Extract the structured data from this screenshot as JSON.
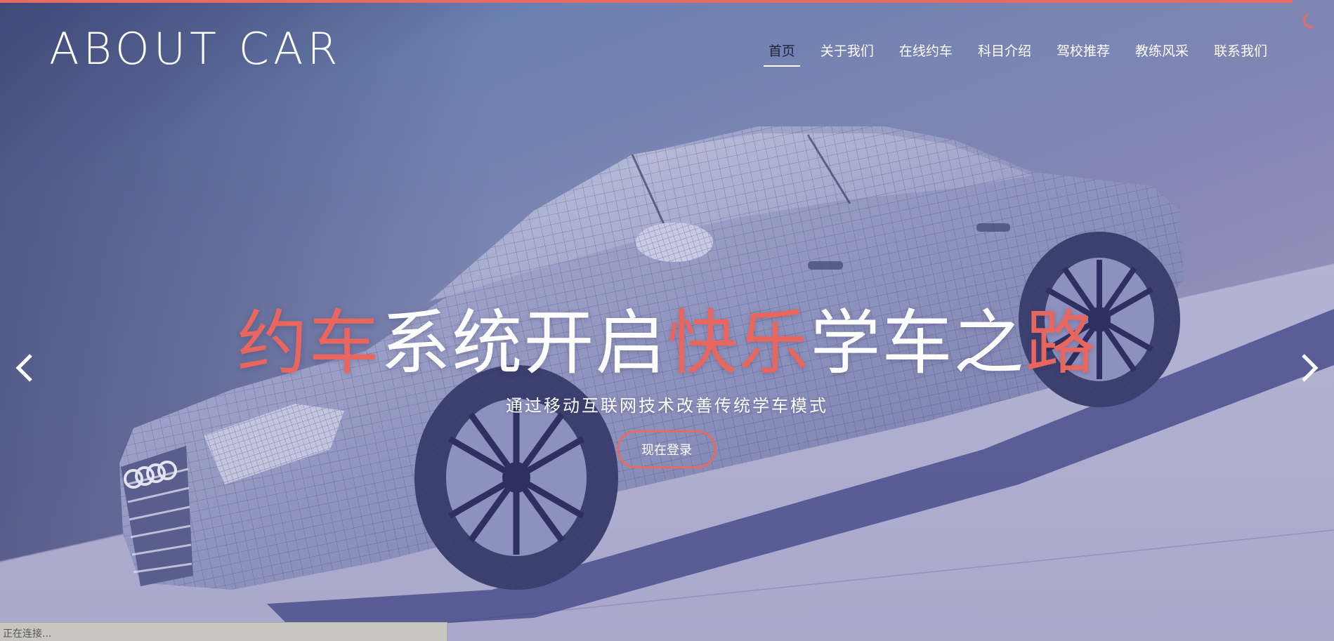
{
  "brand": {
    "logo_text": "ABOUT CAR"
  },
  "nav": {
    "items": [
      {
        "label": "首页",
        "active": true
      },
      {
        "label": "关于我们"
      },
      {
        "label": "在线约车"
      },
      {
        "label": "科目介绍"
      },
      {
        "label": "驾校推荐"
      },
      {
        "label": "教练风采"
      },
      {
        "label": "联系我们"
      }
    ]
  },
  "hero": {
    "headline_parts": [
      {
        "text": "约车",
        "color": "red"
      },
      {
        "text": "系统开启",
        "color": "white"
      },
      {
        "text": "快乐",
        "color": "red"
      },
      {
        "text": "学车之",
        "color": "white"
      },
      {
        "text": "路",
        "color": "red"
      }
    ],
    "subtitle": "通过移动互联网技术改善传统学车模式",
    "cta_label": "现在登录"
  },
  "slider": {
    "prev_icon": "chevron-left-icon",
    "next_icon": "chevron-right-icon"
  },
  "status_bar": {
    "text": "正在连接..."
  },
  "colors": {
    "accent": "#e56b63",
    "text_light": "#ffffff",
    "nav_active": "#1f2240"
  }
}
